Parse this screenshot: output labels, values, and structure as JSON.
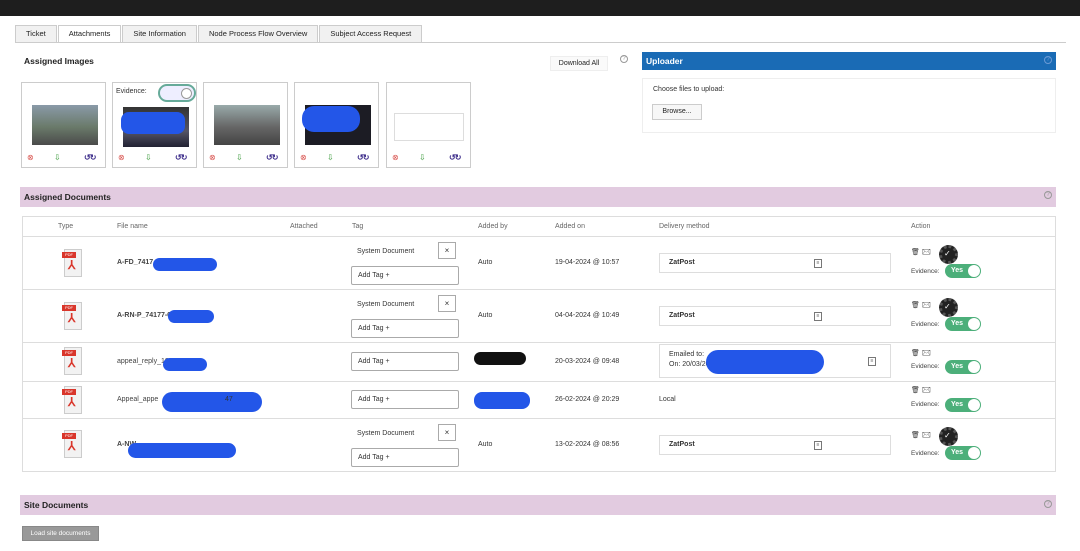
{
  "tabs": [
    "Ticket",
    "Attachments",
    "Site Information",
    "Node Process Flow Overview",
    "Subject Access Request"
  ],
  "assigned_images": {
    "title": "Assigned Images",
    "download_all": "Download All",
    "evidence_label": "Evidence:",
    "thumb_icons": {
      "delete": "⊗",
      "download": "⇩",
      "rotate": "↺↻"
    }
  },
  "uploader": {
    "title": "Uploader",
    "choose_label": "Choose files to upload:",
    "browse": "Browse..."
  },
  "help_icon": "?",
  "assigned_documents": {
    "title": "Assigned Documents",
    "headers": {
      "type": "Type",
      "file_name": "File name",
      "attached": "Attached",
      "tag": "Tag",
      "added_by": "Added by",
      "added_on": "Added on",
      "delivery": "Delivery method",
      "action": "Action"
    },
    "rows": [
      {
        "file": "A-FD_7417",
        "tag": "System Document",
        "add_tag": "Add Tag +",
        "added_by": "Auto",
        "added_on": "19-04-2024 @ 10:57",
        "delivery": "ZatPost",
        "evidence": "Evidence:",
        "yes": "Yes"
      },
      {
        "file": "A-RN-P_74177-04-04",
        "tag": "System Document",
        "add_tag": "Add Tag +",
        "added_by": "Auto",
        "added_on": "04-04-2024 @ 10:49",
        "delivery": "ZatPost",
        "evidence": "Evidence:",
        "yes": "Yes"
      },
      {
        "file": "appeal_reply_10000",
        "add_tag": "Add Tag +",
        "added_on": "20-03-2024 @ 09:48",
        "delivery_line1": "Emailed to:",
        "delivery_line2": "On: 20/03/2024",
        "evidence": "Evidence:",
        "yes": "Yes"
      },
      {
        "file": "Appeal_appe",
        "file_tail": "47",
        "add_tag": "Add Tag +",
        "added_on": "26-02-2024 @ 20:29",
        "delivery": "Local",
        "evidence": "Evidence:",
        "yes": "Yes"
      },
      {
        "file": "A-NW",
        "tag": "System Document",
        "add_tag": "Add Tag +",
        "added_by": "Auto",
        "added_on": "13-02-2024 @ 08:56",
        "delivery": "ZatPost",
        "evidence": "Evidence:",
        "yes": "Yes"
      }
    ],
    "close_glyph": "×",
    "pdf_label": "PDF",
    "doc_glyph": "≡",
    "trash_glyph": "🗑",
    "mail_glyph": "✉",
    "check_glyph": "✓"
  },
  "site_documents": {
    "title": "Site Documents",
    "load_button": "Load site documents"
  }
}
